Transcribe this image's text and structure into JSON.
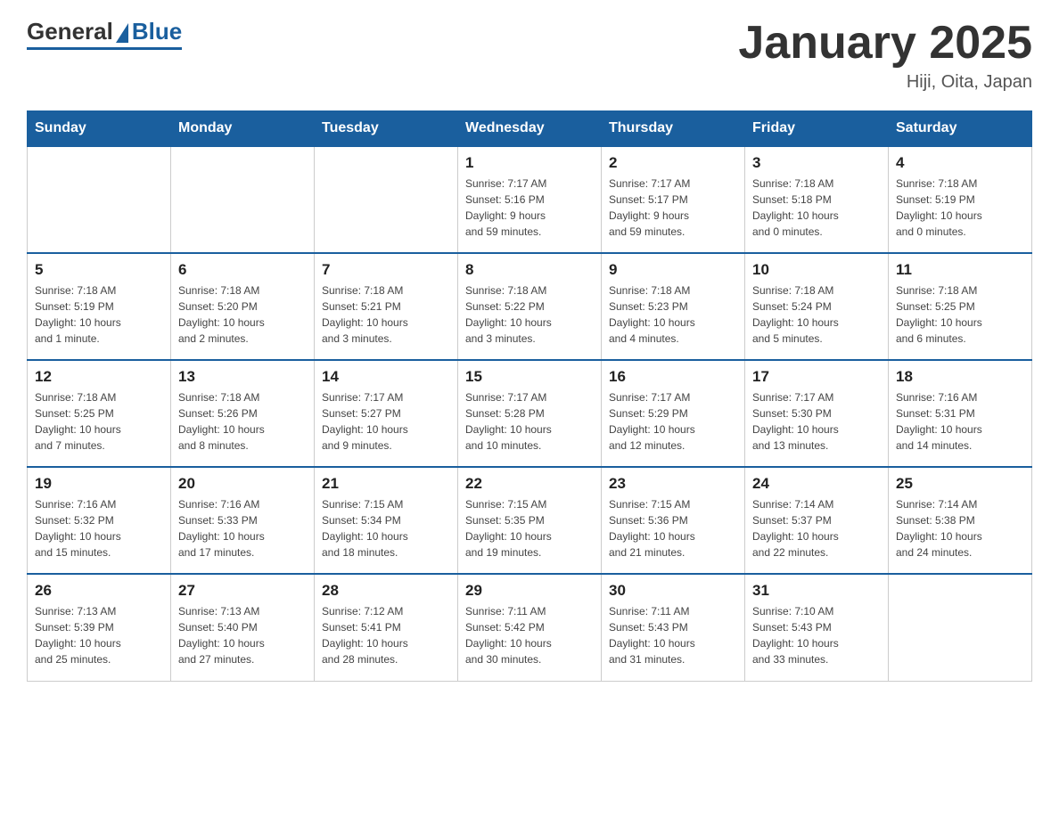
{
  "logo": {
    "general": "General",
    "blue": "Blue"
  },
  "title": "January 2025",
  "subtitle": "Hiji, Oita, Japan",
  "days_of_week": [
    "Sunday",
    "Monday",
    "Tuesday",
    "Wednesday",
    "Thursday",
    "Friday",
    "Saturday"
  ],
  "weeks": [
    [
      {
        "day": "",
        "info": ""
      },
      {
        "day": "",
        "info": ""
      },
      {
        "day": "",
        "info": ""
      },
      {
        "day": "1",
        "info": "Sunrise: 7:17 AM\nSunset: 5:16 PM\nDaylight: 9 hours\nand 59 minutes."
      },
      {
        "day": "2",
        "info": "Sunrise: 7:17 AM\nSunset: 5:17 PM\nDaylight: 9 hours\nand 59 minutes."
      },
      {
        "day": "3",
        "info": "Sunrise: 7:18 AM\nSunset: 5:18 PM\nDaylight: 10 hours\nand 0 minutes."
      },
      {
        "day": "4",
        "info": "Sunrise: 7:18 AM\nSunset: 5:19 PM\nDaylight: 10 hours\nand 0 minutes."
      }
    ],
    [
      {
        "day": "5",
        "info": "Sunrise: 7:18 AM\nSunset: 5:19 PM\nDaylight: 10 hours\nand 1 minute."
      },
      {
        "day": "6",
        "info": "Sunrise: 7:18 AM\nSunset: 5:20 PM\nDaylight: 10 hours\nand 2 minutes."
      },
      {
        "day": "7",
        "info": "Sunrise: 7:18 AM\nSunset: 5:21 PM\nDaylight: 10 hours\nand 3 minutes."
      },
      {
        "day": "8",
        "info": "Sunrise: 7:18 AM\nSunset: 5:22 PM\nDaylight: 10 hours\nand 3 minutes."
      },
      {
        "day": "9",
        "info": "Sunrise: 7:18 AM\nSunset: 5:23 PM\nDaylight: 10 hours\nand 4 minutes."
      },
      {
        "day": "10",
        "info": "Sunrise: 7:18 AM\nSunset: 5:24 PM\nDaylight: 10 hours\nand 5 minutes."
      },
      {
        "day": "11",
        "info": "Sunrise: 7:18 AM\nSunset: 5:25 PM\nDaylight: 10 hours\nand 6 minutes."
      }
    ],
    [
      {
        "day": "12",
        "info": "Sunrise: 7:18 AM\nSunset: 5:25 PM\nDaylight: 10 hours\nand 7 minutes."
      },
      {
        "day": "13",
        "info": "Sunrise: 7:18 AM\nSunset: 5:26 PM\nDaylight: 10 hours\nand 8 minutes."
      },
      {
        "day": "14",
        "info": "Sunrise: 7:17 AM\nSunset: 5:27 PM\nDaylight: 10 hours\nand 9 minutes."
      },
      {
        "day": "15",
        "info": "Sunrise: 7:17 AM\nSunset: 5:28 PM\nDaylight: 10 hours\nand 10 minutes."
      },
      {
        "day": "16",
        "info": "Sunrise: 7:17 AM\nSunset: 5:29 PM\nDaylight: 10 hours\nand 12 minutes."
      },
      {
        "day": "17",
        "info": "Sunrise: 7:17 AM\nSunset: 5:30 PM\nDaylight: 10 hours\nand 13 minutes."
      },
      {
        "day": "18",
        "info": "Sunrise: 7:16 AM\nSunset: 5:31 PM\nDaylight: 10 hours\nand 14 minutes."
      }
    ],
    [
      {
        "day": "19",
        "info": "Sunrise: 7:16 AM\nSunset: 5:32 PM\nDaylight: 10 hours\nand 15 minutes."
      },
      {
        "day": "20",
        "info": "Sunrise: 7:16 AM\nSunset: 5:33 PM\nDaylight: 10 hours\nand 17 minutes."
      },
      {
        "day": "21",
        "info": "Sunrise: 7:15 AM\nSunset: 5:34 PM\nDaylight: 10 hours\nand 18 minutes."
      },
      {
        "day": "22",
        "info": "Sunrise: 7:15 AM\nSunset: 5:35 PM\nDaylight: 10 hours\nand 19 minutes."
      },
      {
        "day": "23",
        "info": "Sunrise: 7:15 AM\nSunset: 5:36 PM\nDaylight: 10 hours\nand 21 minutes."
      },
      {
        "day": "24",
        "info": "Sunrise: 7:14 AM\nSunset: 5:37 PM\nDaylight: 10 hours\nand 22 minutes."
      },
      {
        "day": "25",
        "info": "Sunrise: 7:14 AM\nSunset: 5:38 PM\nDaylight: 10 hours\nand 24 minutes."
      }
    ],
    [
      {
        "day": "26",
        "info": "Sunrise: 7:13 AM\nSunset: 5:39 PM\nDaylight: 10 hours\nand 25 minutes."
      },
      {
        "day": "27",
        "info": "Sunrise: 7:13 AM\nSunset: 5:40 PM\nDaylight: 10 hours\nand 27 minutes."
      },
      {
        "day": "28",
        "info": "Sunrise: 7:12 AM\nSunset: 5:41 PM\nDaylight: 10 hours\nand 28 minutes."
      },
      {
        "day": "29",
        "info": "Sunrise: 7:11 AM\nSunset: 5:42 PM\nDaylight: 10 hours\nand 30 minutes."
      },
      {
        "day": "30",
        "info": "Sunrise: 7:11 AM\nSunset: 5:43 PM\nDaylight: 10 hours\nand 31 minutes."
      },
      {
        "day": "31",
        "info": "Sunrise: 7:10 AM\nSunset: 5:43 PM\nDaylight: 10 hours\nand 33 minutes."
      },
      {
        "day": "",
        "info": ""
      }
    ]
  ]
}
